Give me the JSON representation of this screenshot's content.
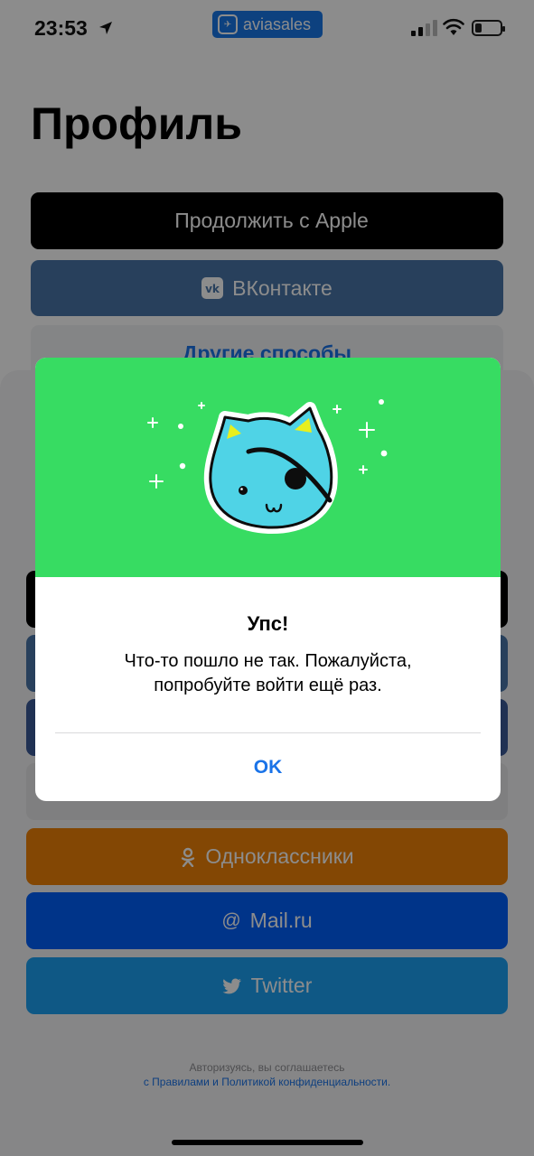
{
  "status_bar": {
    "time": "23:53",
    "app_badge": "aviasales"
  },
  "profile": {
    "title": "Профиль",
    "apple_button": "Продолжить с Apple",
    "vk_button": "ВКонтакте",
    "other_button": "Другие способы"
  },
  "sheet": {
    "buttons": {
      "odnoklassniki": "Одноклассники",
      "mailru": "Mail.ru",
      "twitter": "Twitter"
    },
    "legal_line1": "Авторизуясь, вы соглашаетесь",
    "legal_line2": "с Правилами и Политикой конфиденциальности."
  },
  "dialog": {
    "title": "Упс!",
    "message_line1": "Что-то пошло не так. Пожалуйста,",
    "message_line2": "попробуйте войти ещё раз.",
    "ok_label": "OK"
  },
  "colors": {
    "hero_green": "#37dc62",
    "cat_blue": "#4fd3e6",
    "link_blue": "#1a73e8",
    "odnoklassniki": "#ee8208",
    "mailru": "#005ff9",
    "twitter": "#1da1f2"
  },
  "icons": [
    "location-arrow-icon",
    "aviasales-logo-icon",
    "signal-icon",
    "wifi-icon",
    "battery-icon",
    "apple-icon",
    "vk-icon",
    "odnoklassniki-icon",
    "at-icon",
    "twitter-bird-icon",
    "pirate-cat-illustration"
  ]
}
